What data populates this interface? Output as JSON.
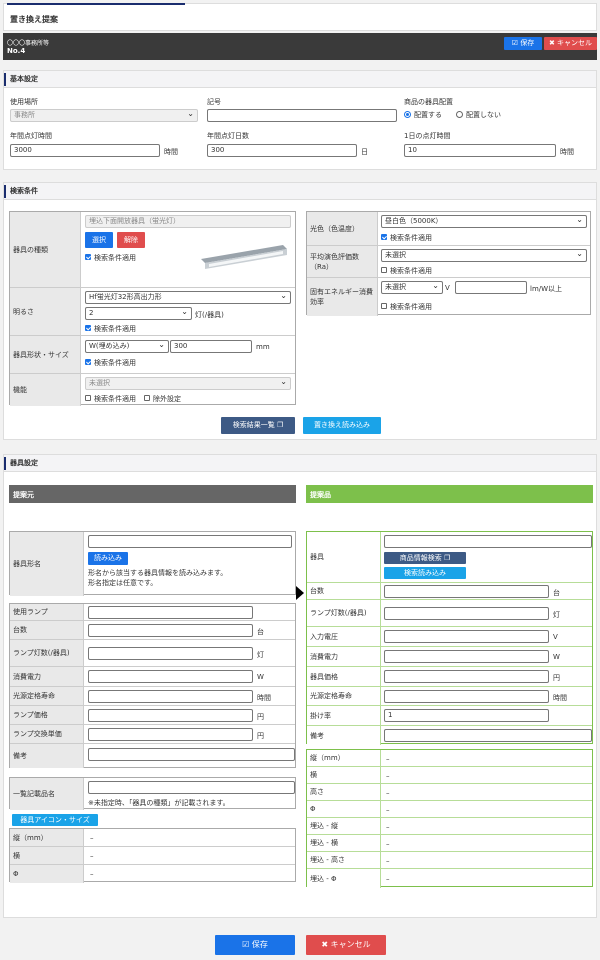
{
  "page_title": "置き換え提案",
  "header": {
    "office": "〇〇〇事務所等",
    "number": "No.4",
    "save": "保存",
    "cancel": "キャンセル"
  },
  "basic": {
    "title": "基本設定",
    "location_label": "使用場所",
    "location_value": "事務所",
    "symbol_label": "記号",
    "symbol_value": "",
    "placement_label": "商品の器具配置",
    "placement_yes": "配置する",
    "placement_no": "配置しない",
    "annual_label": "年間点灯時間",
    "annual_value": "3000",
    "annual_unit": "時間",
    "days_label": "年間点灯日数",
    "days_value": "300",
    "days_unit": "日",
    "daily_label": "1日の点灯時間",
    "daily_value": "10",
    "daily_unit": "時間"
  },
  "search": {
    "title": "検索条件",
    "type_label": "器具の種類",
    "type_value": "埋込下面開放器具（蛍光灯）",
    "select_btn": "選択",
    "clear_btn": "解除",
    "apply": "検索条件適用",
    "brightness_label": "明るさ",
    "brightness_value": "Hf蛍光灯32形高出力形",
    "lamp_count": "2",
    "lamp_unit": "灯(/器具)",
    "shape_label": "器具形状・サイズ",
    "shape_value": "W(埋め込み)",
    "shape_size": "300",
    "shape_unit": "mm",
    "function_label": "機能",
    "function_value": "未選択",
    "exclude": "除外設定",
    "color_label": "光色（色温度）",
    "color_value": "昼白色（5000K）",
    "cri_label": "平均演色評価数（Ra）",
    "cri_value": "未選択",
    "eff_label": "固有エネルギー消費効率",
    "eff_value": "未選択",
    "eff_unit1": "V",
    "eff_unit2": "lm/W以上",
    "result_btn": "検索結果一覧",
    "import_btn": "置き換え読み込み"
  },
  "fixture": {
    "title": "器具設定",
    "source_title": "提案元",
    "proposal_title": "提案品",
    "model_label": "器具形名",
    "read_btn": "読み込み",
    "model_note1": "形名から該当する器具情報を読み込みます。",
    "model_note2": "形名指定は任意です。",
    "lamp_label": "使用ランプ",
    "count_label": "台数",
    "count_unit": "台",
    "lamps_label": "ランプ灯数(/器具)",
    "lamps_unit": "灯",
    "power_label": "消費電力",
    "power_unit": "W",
    "life_label": "光源定格寿命",
    "life_unit": "時間",
    "lamp_price_label": "ランプ価格",
    "yen": "円",
    "lamp_change_label": "ランプ交換単価",
    "note_label": "備考",
    "list_name_label": "一覧記載品名",
    "list_name_note": "※未指定時、「器具の種類」が記載されます。",
    "icon_size_btn": "器具アイコン・サイズ",
    "depth_label": "縦（mm）",
    "width_label": "横",
    "phi_label": "Φ",
    "dash": "–",
    "p_fixture_label": "器具",
    "p_info_btn": "商品情報検索",
    "p_read_btn": "検索読み込み",
    "p_count_label": "台数",
    "p_lamps_label": "ランプ灯数(/器具)",
    "p_voltage_label": "入力電圧",
    "p_voltage_unit": "V",
    "p_power_label": "消費電力",
    "p_price_label": "器具価格",
    "p_life_label": "光源定格寿命",
    "p_rate_label": "掛け率",
    "p_rate_value": "1",
    "p_note_label": "備考",
    "p_height_label": "高さ",
    "p_emb_d": "埋込 - 縦",
    "p_emb_w": "埋込 - 横",
    "p_emb_h": "埋込 - 高さ",
    "p_emb_phi": "埋込 - Φ"
  },
  "footer": {
    "save": "保存",
    "cancel": "キャンセル"
  },
  "colors": {
    "navy": "#1a2d6e",
    "blue": "#1a73e8",
    "red": "#e04d4d",
    "green": "#7dc04b",
    "dark": "#3a3a3a"
  }
}
